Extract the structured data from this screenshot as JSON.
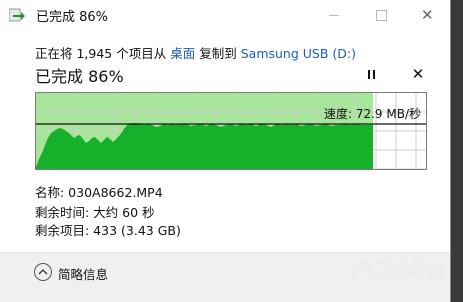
{
  "window": {
    "title": "已完成 86%",
    "colors": {
      "graph_fill": "#16b02a",
      "graph_bg": "#a6e59a",
      "grid": "#cfcfcf",
      "link": "#1a5fb4"
    }
  },
  "copy": {
    "prefix": "正在将 1,945 个项目从",
    "source": "桌面",
    "middle": "复制到",
    "destination": "Samsung USB (D:)"
  },
  "progress": {
    "heading": "已完成 86%",
    "percent": 86,
    "speed_label": "速度: 72.9 MB/秒"
  },
  "details": {
    "name": "名称: 030A8662.MP4",
    "time_remaining": "剩余时间: 大约 60 秒",
    "items_remaining": "剩余项目: 433 (3.43 GB)"
  },
  "footer": {
    "toggle_label": "简略信息"
  },
  "watermark": "PConline"
}
